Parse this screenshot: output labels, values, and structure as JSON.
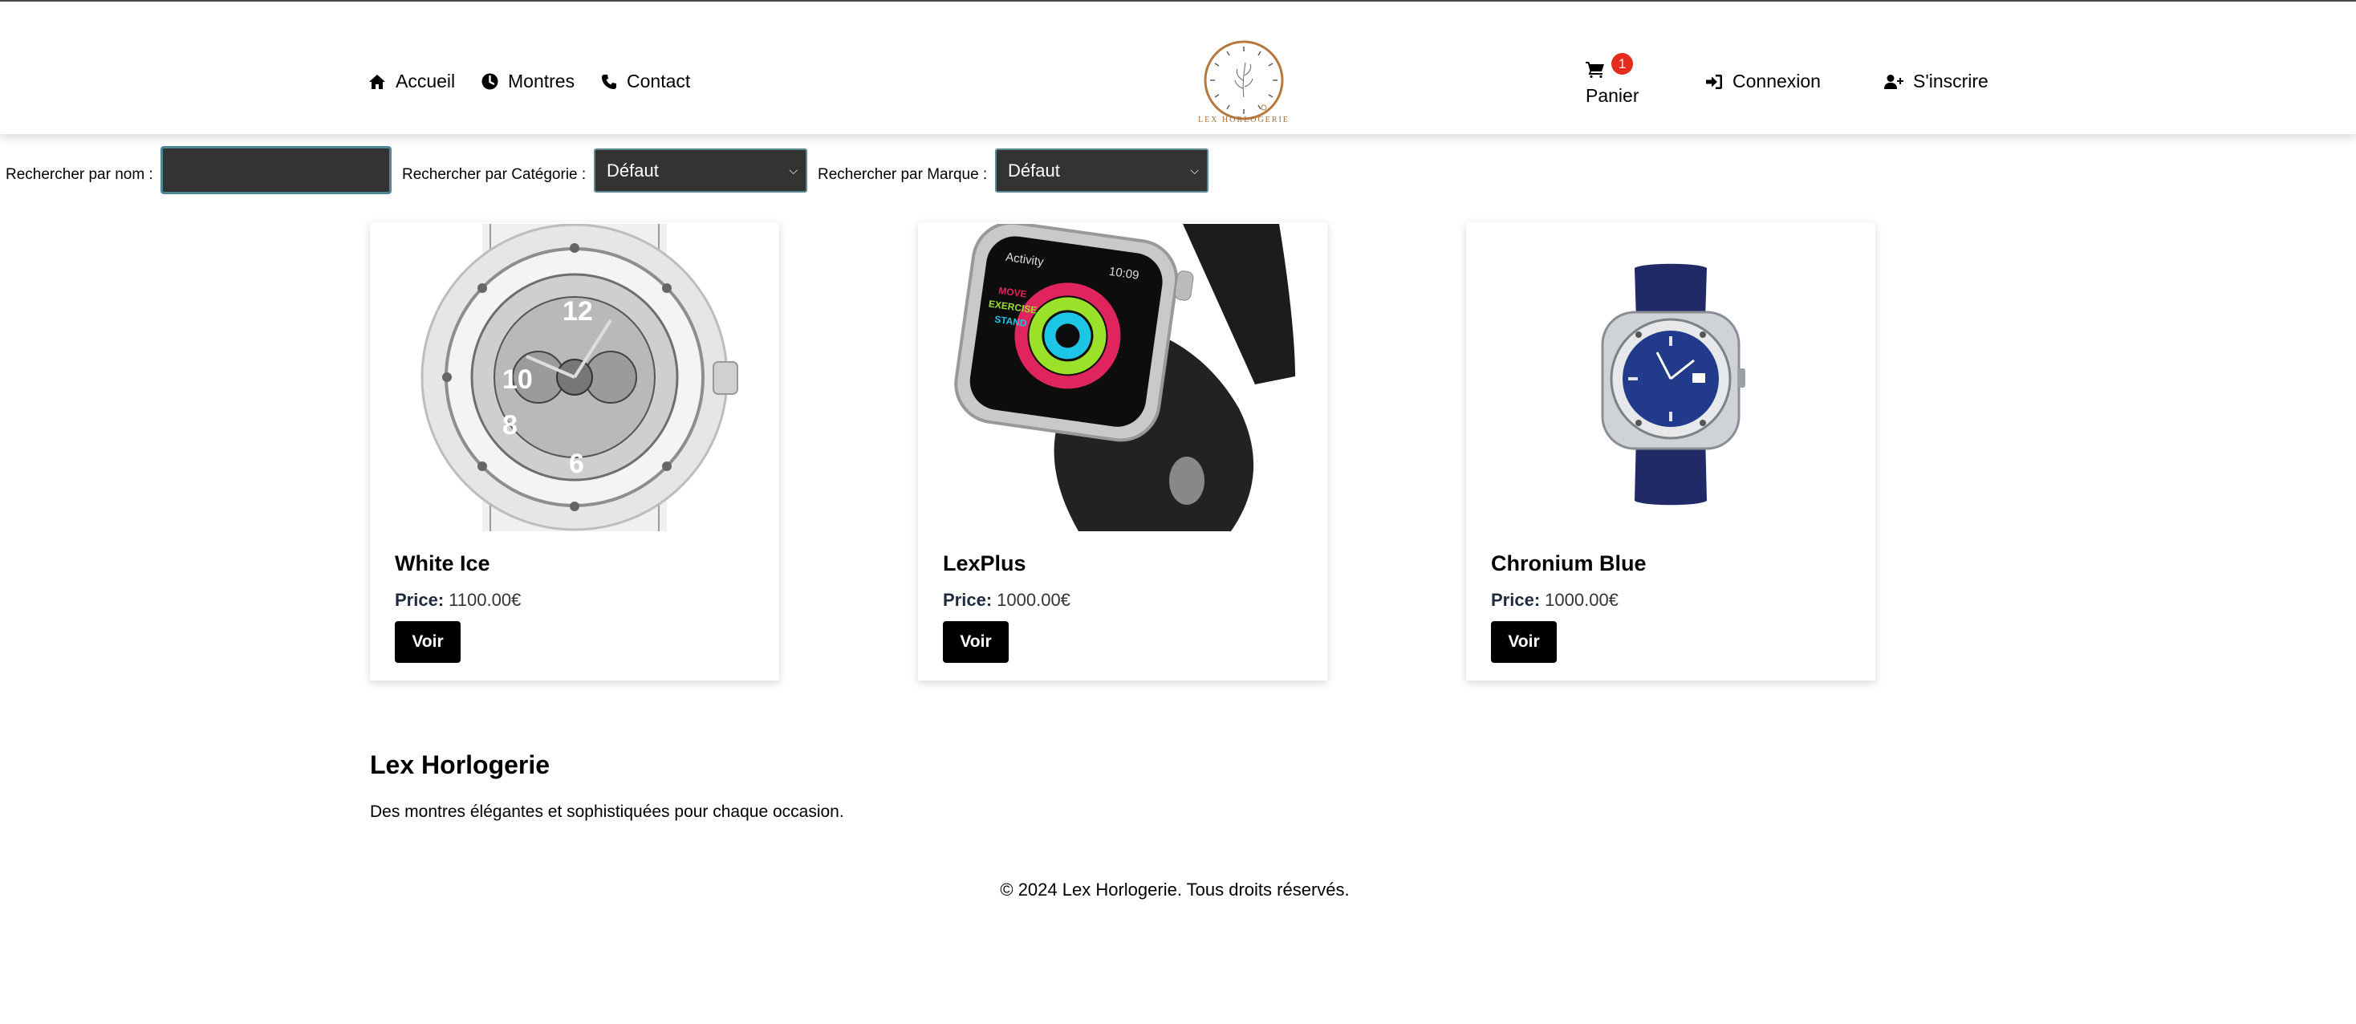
{
  "nav": {
    "home": "Accueil",
    "watches": "Montres",
    "contact": "Contact",
    "cart_label": "Panier",
    "cart_count": "1",
    "login": "Connexion",
    "signup": "S'inscrire"
  },
  "logo": {
    "text": "LEX HORLOGERIE",
    "accent_color": "#b5793f"
  },
  "search": {
    "name_label": "Rechercher par nom :",
    "name_value": "",
    "category_label": "Rechercher par Catégorie :",
    "category_selected": "Défaut",
    "brand_label": "Rechercher par Marque :",
    "brand_selected": "Défaut"
  },
  "products": [
    {
      "name": "White Ice",
      "price_label": "Price:",
      "price": "1100.00€",
      "button": "Voir",
      "image": "transparent-chronograph-watch"
    },
    {
      "name": "LexPlus",
      "price_label": "Price:",
      "price": "1000.00€",
      "button": "Voir",
      "image": "smartwatch-black-band",
      "screen_text": [
        "Activity",
        "10:09",
        "MOVE",
        "EXERCISE",
        "STAND"
      ]
    },
    {
      "name": "Chronium Blue",
      "price_label": "Price:",
      "price": "1000.00€",
      "button": "Voir",
      "image": "blue-dial-watch"
    }
  ],
  "footer": {
    "title": "Lex Horlogerie",
    "description": "Des montres élégantes et sophistiquées pour chaque occasion.",
    "copyright": "© 2024 Lex Horlogerie. Tous droits réservés."
  },
  "colors": {
    "badge": "#e32b1e",
    "input_bg": "#333333",
    "button_bg": "#000000"
  }
}
